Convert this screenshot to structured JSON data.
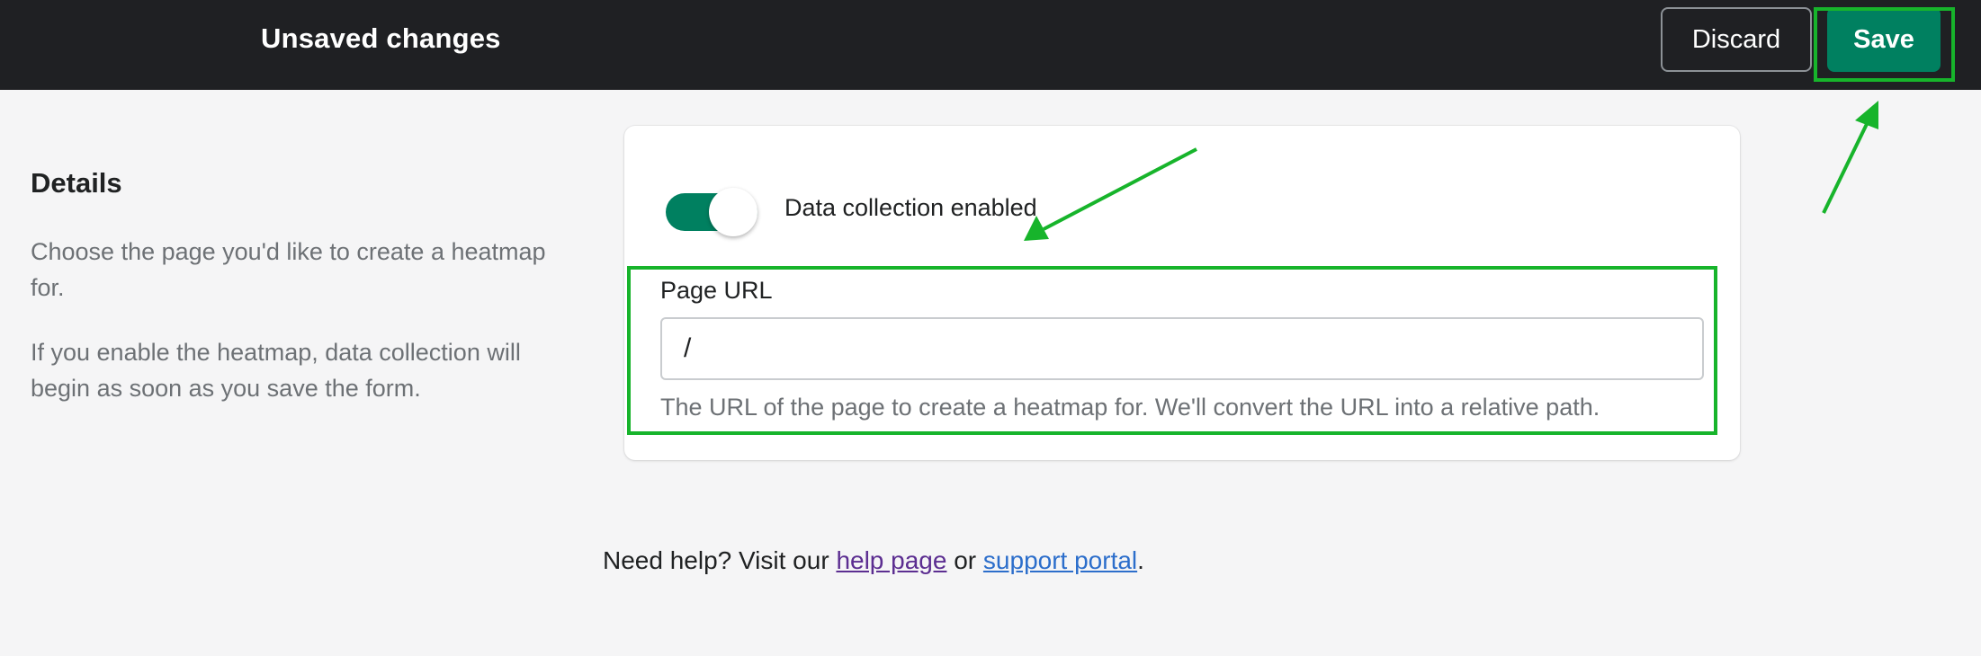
{
  "topbar": {
    "title": "Unsaved changes",
    "discard_label": "Discard",
    "save_label": "Save"
  },
  "details": {
    "heading": "Details",
    "description_1": "Choose the page you'd like to create a heatmap for.",
    "description_2": "If you enable the heatmap, data collection will begin as soon as you save the form."
  },
  "form": {
    "toggle_label": "Data collection enabled",
    "toggle_on": true,
    "url_label": "Page URL",
    "url_value": "/",
    "url_help": "The URL of the page to create a heatmap for. We'll convert the URL into a relative path."
  },
  "footer": {
    "prefix": "Need help? Visit our ",
    "help_link": "help page",
    "middle": " or ",
    "support_link": "support portal",
    "suffix": "."
  },
  "colors": {
    "topbar_bg": "#1f2023",
    "primary_green": "#008060",
    "annotation_green": "#17b42b"
  }
}
